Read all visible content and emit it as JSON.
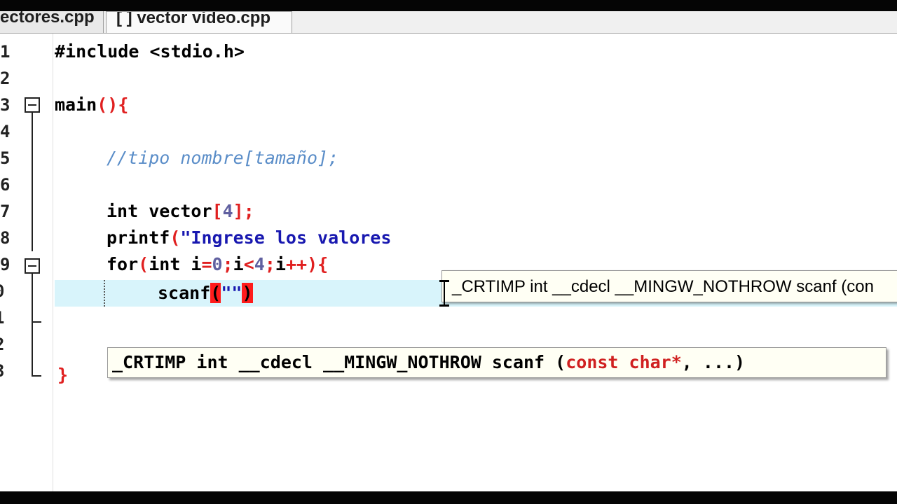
{
  "tabs": [
    {
      "label": "ectores.cpp"
    },
    {
      "label": "[ ] vector video.cpp"
    }
  ],
  "gutter": {
    "line_numbers": [
      "1",
      "2",
      "3",
      "4",
      "5",
      "6",
      "7",
      "8",
      "9",
      "0",
      "1",
      "2",
      "3"
    ]
  },
  "code": {
    "line1": "#include <stdio.h>",
    "line3_fn": "main",
    "line3_sym": "(){",
    "line5_comment": "//tipo nombre[tamaño];",
    "line7_kw": "int",
    "line7_id": " vector",
    "line7_open": "[",
    "line7_num": "4",
    "line7_close": "];",
    "line8_fn": "printf",
    "line8_open": "(",
    "line8_str": "\"Ingrese los valores",
    "line9_for": "for",
    "line9_open": "(",
    "line9_int": "int",
    "line9_a": " i",
    "line9_eq": "=",
    "line9_0": "0",
    "line9_semi1": ";",
    "line9_b": "i",
    "line9_lt": "<",
    "line9_4": "4",
    "line9_semi2": ";",
    "line9_c": "i",
    "line9_pp": "++){",
    "line10_fn": "scanf",
    "line10_open": "(",
    "line10_str": "\"\"",
    "line10_close": ")",
    "line13_close": "}"
  },
  "tooltips": {
    "hint_top": "_CRTIMP int __cdecl __MINGW_NOTHROW scanf (con",
    "hint_main_prefix": "_CRTIMP int __cdecl __MINGW_NOTHROW scanf (",
    "hint_main_params": "const char*",
    "hint_main_suffix": ", ...)"
  },
  "colors": {
    "current_line": "#d8f4fb",
    "brace_highlight": "#ff1c1c",
    "comment": "#5a8dc8",
    "string": "#1818b0",
    "symbol": "#e02020"
  }
}
